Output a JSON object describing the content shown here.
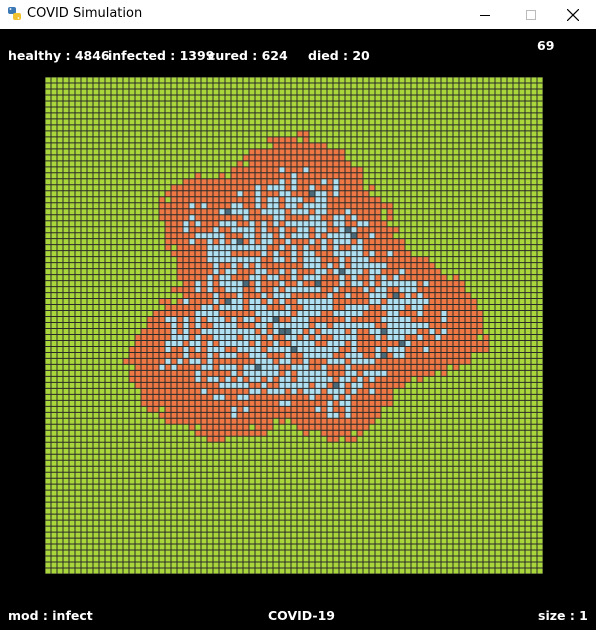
{
  "window": {
    "title": "COVID Simulation",
    "icon": "python-snake-icon",
    "controls": [
      "minimize-icon",
      "maximize-icon",
      "close-icon"
    ]
  },
  "stats": {
    "healthy_label": "healthy : 4846",
    "infected_label": "infected : 1399",
    "cured_label": "cured : 624",
    "died_label": "died : 20",
    "tick": "69"
  },
  "footer": {
    "mode_label": "mod : infect",
    "name": "COVID-19",
    "size_label": "size : 1"
  },
  "grid": {
    "columns": 83,
    "rows": 83,
    "colors": {
      "background": "#000000",
      "grid_line": "#2a2a2a",
      "healthy": "#a9d63a",
      "infected": "#ee7744",
      "cured": "#aee0f2",
      "died": "#4a6a7a"
    }
  }
}
